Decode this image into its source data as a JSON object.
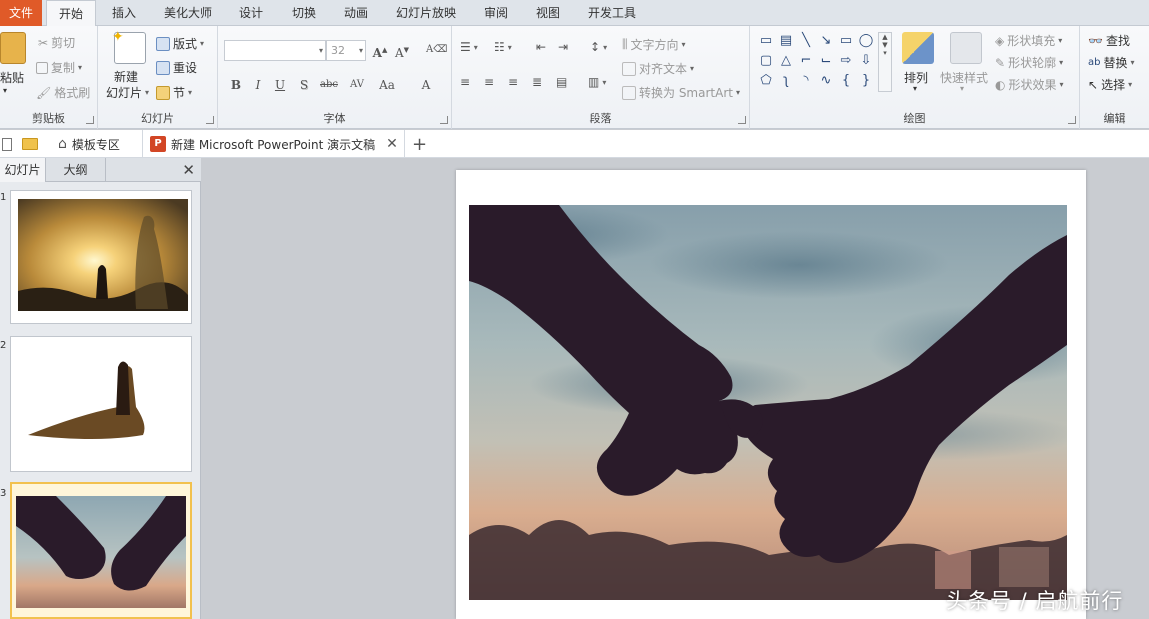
{
  "ribbon_tabs": [
    "文件",
    "开始",
    "插入",
    "美化大师",
    "设计",
    "切换",
    "动画",
    "幻灯片放映",
    "审阅",
    "视图",
    "开发工具"
  ],
  "clipboard": {
    "paste": "粘贴",
    "cut": "剪切",
    "copy": "复制",
    "format_painter": "格式刷",
    "label": "剪贴板"
  },
  "slides_group": {
    "new_slide_line1": "新建",
    "new_slide_line2": "幻灯片",
    "layout": "版式",
    "reset": "重设",
    "section": "节",
    "label": "幻灯片"
  },
  "font_group": {
    "font_size": "32",
    "label": "字体",
    "buttons": [
      "B",
      "I",
      "U",
      "S",
      "abc",
      "AV",
      "Aa",
      "A"
    ]
  },
  "paragraph_group": {
    "text_direction": "文字方向",
    "align_text": "对齐文本",
    "convert_smartart": "转换为 SmartArt",
    "label": "段落"
  },
  "drawing_group": {
    "arrange": "排列",
    "quick_styles": "快速样式",
    "shape_fill": "形状填充",
    "shape_outline": "形状轮廓",
    "shape_effects": "形状效果",
    "label": "绘图"
  },
  "editing_group": {
    "find": "查找",
    "replace": "替换",
    "select": "选择",
    "label": "编辑"
  },
  "doc_tabs": {
    "template_zone": "模板专区",
    "document": "新建 Microsoft PowerPoint 演示文稿"
  },
  "left_pane": {
    "tab_slides": "幻灯片",
    "tab_outline": "大纲",
    "slide_numbers": [
      "1",
      "2",
      "3"
    ]
  },
  "watermark": "头条号 / 启航前行",
  "colors": {
    "file_tab": "#e05a28",
    "selected_thumb_border": "#f2c14e",
    "silhouette": "#2a1b2a"
  }
}
